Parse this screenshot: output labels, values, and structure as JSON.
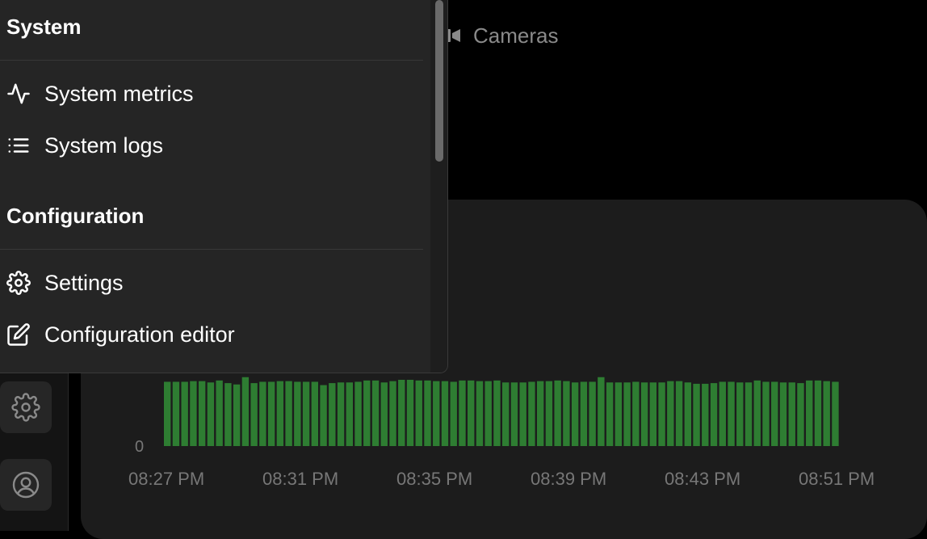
{
  "header": {
    "cameras_label": "Cameras"
  },
  "sidebar": {
    "icons": [
      "gear-icon",
      "user-icon"
    ]
  },
  "menu": {
    "sections": [
      {
        "heading": "System",
        "items": [
          {
            "label": "System metrics",
            "icon": "activity-icon"
          },
          {
            "label": "System logs",
            "icon": "list-icon"
          }
        ]
      },
      {
        "heading": "Configuration",
        "items": [
          {
            "label": "Settings",
            "icon": "gear-icon"
          },
          {
            "label": "Configuration editor",
            "icon": "edit-icon"
          }
        ]
      }
    ]
  },
  "chart_data": {
    "type": "bar",
    "title": "",
    "xlabel": "",
    "ylabel": "",
    "y_tick_labels": [
      "0"
    ],
    "x_tick_labels": [
      "08:27 PM",
      "08:31 PM",
      "08:35 PM",
      "08:39 PM",
      "08:43 PM",
      "08:51 PM"
    ],
    "color": "#2e7d32",
    "series": [
      {
        "values": [
          0.97,
          0.97,
          0.97,
          0.98,
          0.98,
          0.96,
          0.99,
          0.95,
          0.93,
          1.04,
          0.95,
          0.97,
          0.97,
          0.98,
          0.98,
          0.97,
          0.97,
          0.97,
          0.92,
          0.95,
          0.96,
          0.96,
          0.97,
          0.99,
          0.99,
          0.96,
          0.98,
          1.0,
          1.0,
          0.99,
          0.99,
          0.98,
          0.98,
          0.97,
          0.99,
          0.99,
          0.98,
          0.98,
          0.99,
          0.96,
          0.96,
          0.96,
          0.97,
          0.98,
          0.98,
          0.99,
          0.98,
          0.96,
          0.97,
          0.97,
          1.04,
          0.96,
          0.96,
          0.96,
          0.97,
          0.96,
          0.96,
          0.96,
          0.98,
          0.98,
          0.96,
          0.94,
          0.94,
          0.95,
          0.97,
          0.97,
          0.96,
          0.96,
          0.99,
          0.97,
          0.97,
          0.96,
          0.96,
          0.95,
          0.99,
          0.99,
          0.98,
          0.97
        ]
      }
    ]
  }
}
